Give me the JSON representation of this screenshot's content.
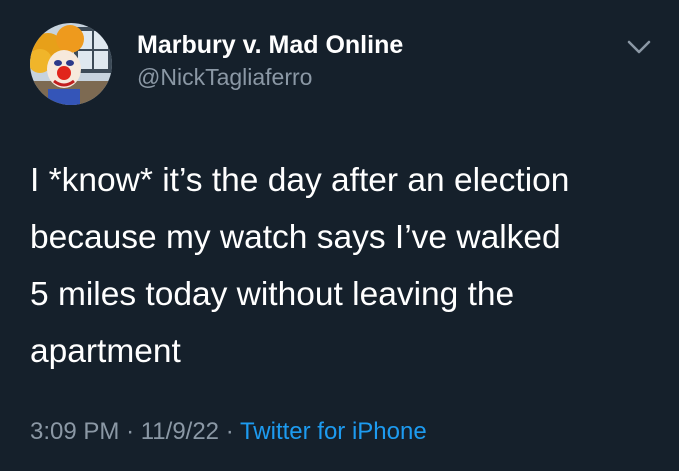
{
  "author": {
    "display_name": "Marbury v. Mad Online",
    "handle": "@NickTagliaferro",
    "avatar_icon": "clown-avatar"
  },
  "tweet": {
    "lines": [
      "I *know* it’s the day after an election",
      "because my watch says I’ve walked",
      "5 miles today without leaving the",
      "apartment"
    ]
  },
  "meta": {
    "time": "3:09 PM",
    "date": "11/9/22",
    "separator": "·",
    "source": "Twitter for iPhone"
  },
  "icons": {
    "menu": "chevron-down-icon"
  },
  "colors": {
    "background": "#15202b",
    "text_primary": "#ffffff",
    "text_secondary": "#8b98a5",
    "link": "#1d9bf0"
  }
}
